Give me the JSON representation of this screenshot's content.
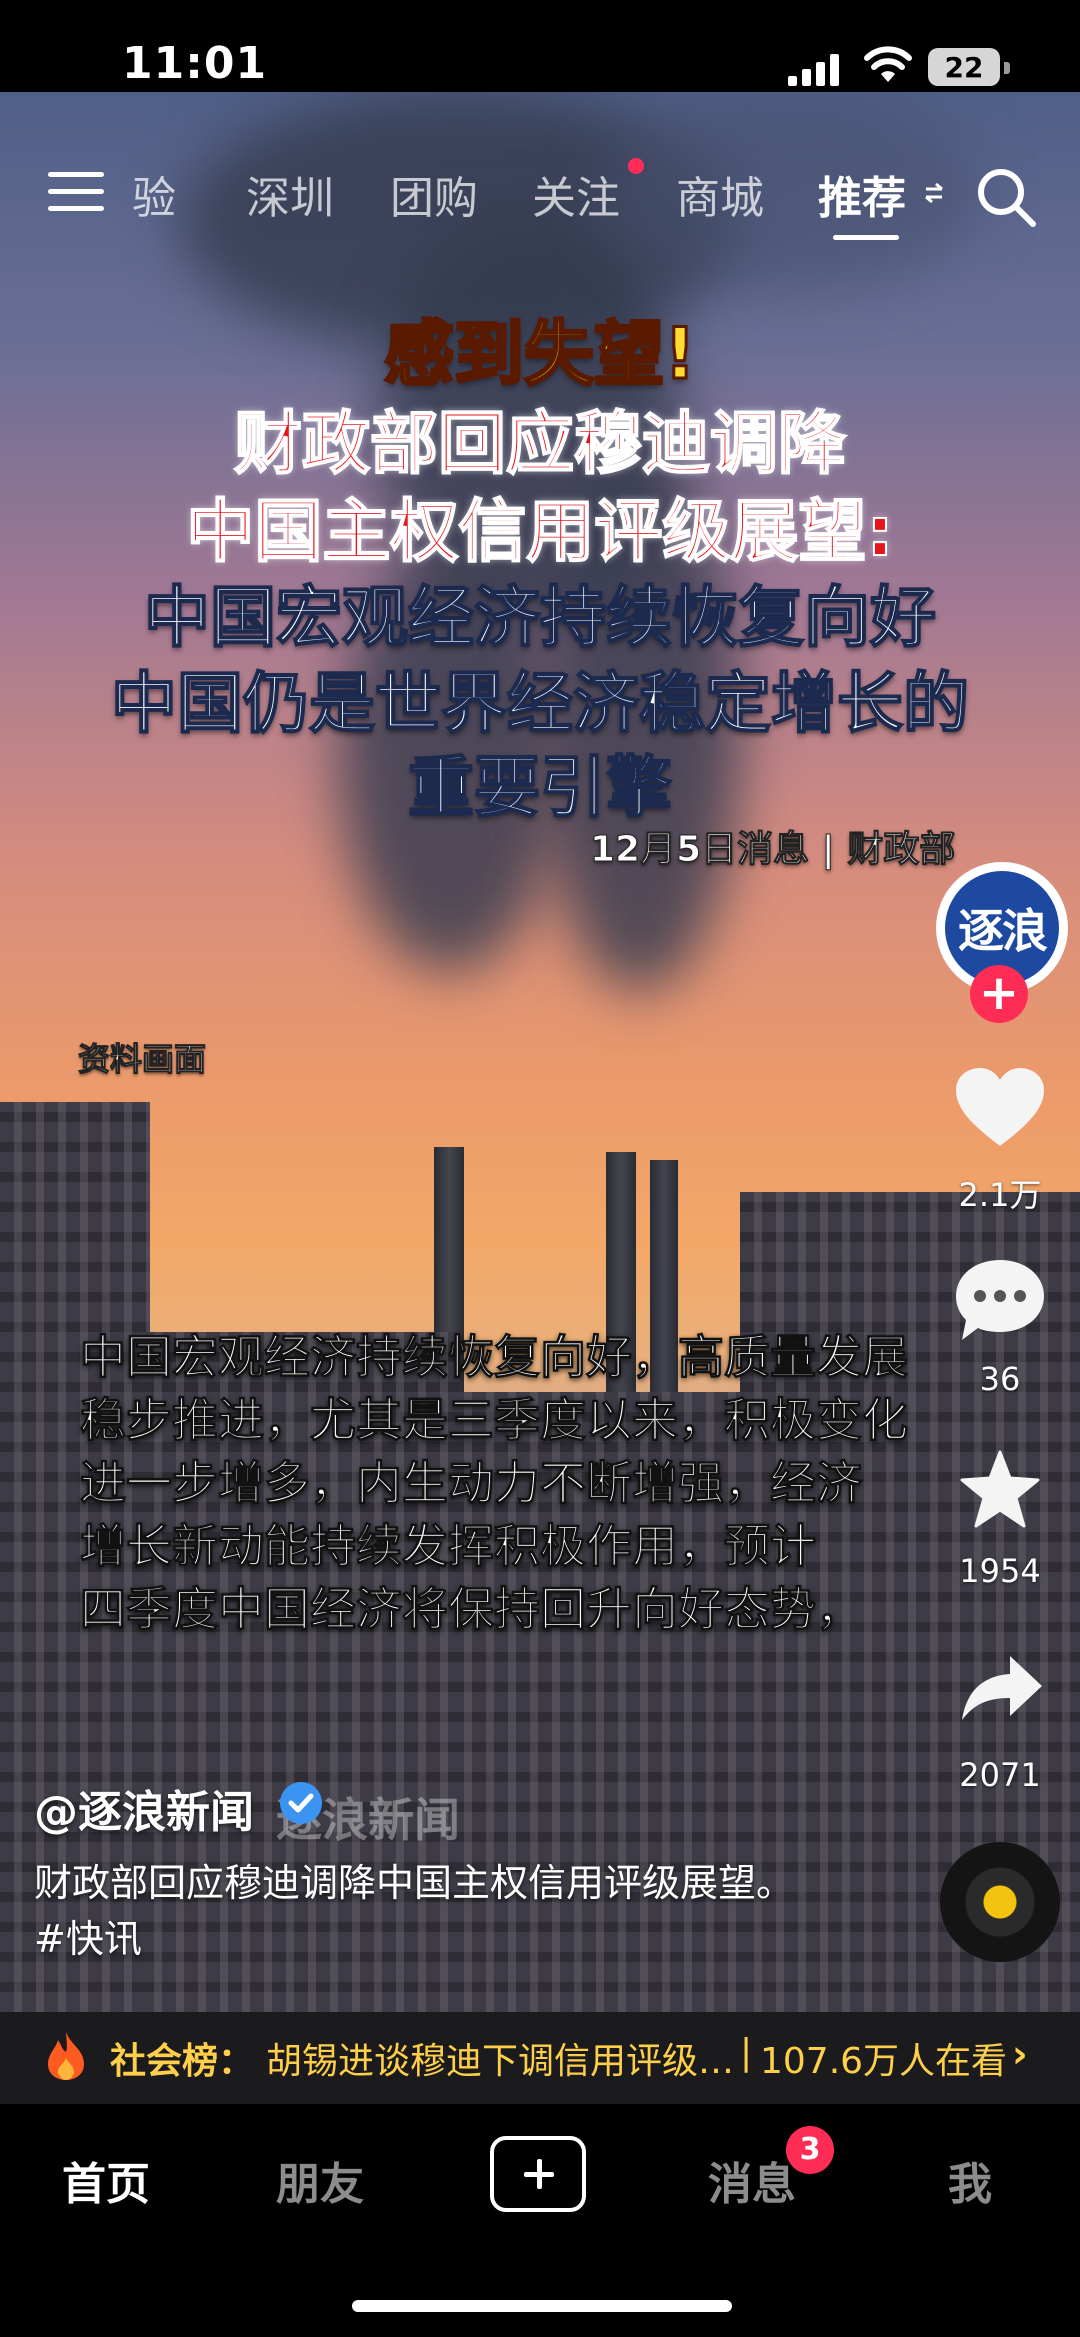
{
  "status_bar": {
    "time": "11:01",
    "battery": "22"
  },
  "top_nav": {
    "tabs": [
      {
        "label": "验"
      },
      {
        "label": "深圳"
      },
      {
        "label": "团购"
      },
      {
        "label": "关注"
      },
      {
        "label": "商城"
      },
      {
        "label": "推荐"
      }
    ],
    "active_tab": "推荐"
  },
  "video": {
    "headline": {
      "line1": "感到失望!",
      "line2": "财政部回应穆迪调降",
      "line3": "中国主权信用评级展望:",
      "line4": "中国宏观经济持续恢复向好",
      "line5": "中国仍是世界经济稳定增长的",
      "line6": "重要引擎",
      "source": "12月5日消息 | 财政部"
    },
    "archive_label": "资料画面",
    "body_lines": [
      "中国宏观经济持续恢复向好，高质量发展",
      "稳步推进，尤其是三季度以来，积极变化",
      "进一步增多，内生动力不断增强，经济",
      "增长新动能持续发挥积极作用，预计",
      "四季度中国经济将保持回升向好态势，"
    ],
    "watermark": "逐浪新闻"
  },
  "right_rail": {
    "avatar_text": "逐浪",
    "likes": "2.1万",
    "comments": "36",
    "favorites": "1954",
    "shares": "2071"
  },
  "caption": {
    "author": "@逐浪新闻",
    "text": "财政部回应穆迪调降中国主权信用评级展望。#快讯"
  },
  "hot_bar": {
    "label": "社会榜：",
    "title": "胡锡进谈穆迪下调信用评级…",
    "separator": "|",
    "viewers": "107.6万人在看"
  },
  "bottom_nav": {
    "home": "首页",
    "friends": "朋友",
    "messages": "消息",
    "messages_badge": "3",
    "me": "我"
  }
}
